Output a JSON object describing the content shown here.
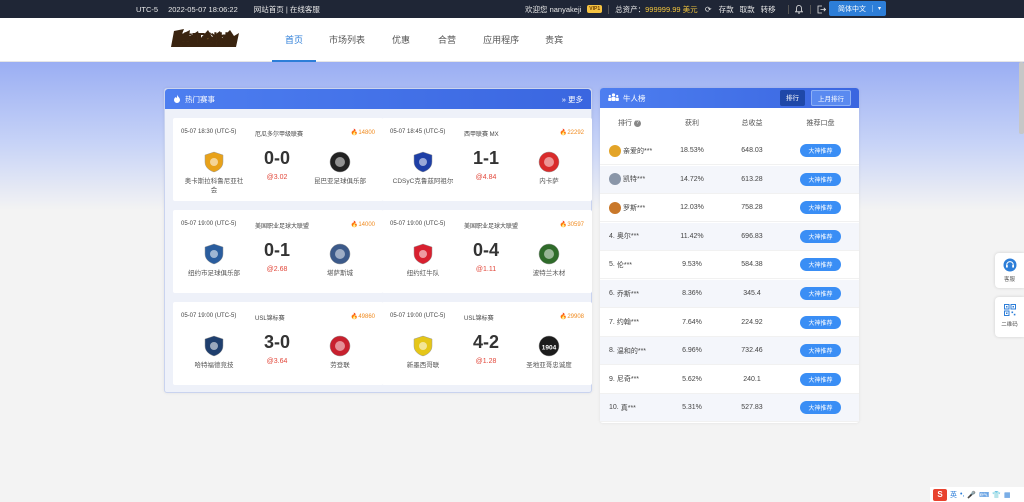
{
  "topbar": {
    "timezone": "UTC-5",
    "datetime": "2022-05-07 18:06:22",
    "links": "网站首页 | 在线客服",
    "welcome": "欢迎您 nanyakeji",
    "vip": "VIP1",
    "assets_label": "总资产：",
    "assets_value": "999999.99 美元",
    "deposit": "存款",
    "withdraw": "取款",
    "transfer": "转移",
    "language": "简体中文"
  },
  "nav": {
    "logo_text": "南亚科技",
    "items": [
      "首页",
      "市场列表",
      "优惠",
      "合营",
      "应用程序",
      "贵宾"
    ]
  },
  "hot": {
    "title": "热门赛事",
    "more": "更多",
    "matches": [
      {
        "time": "05-07 18:30 (UTC-5)",
        "league": "厄瓜多尔甲级联赛",
        "count": "14800",
        "home": "奥卡斯拉科鲁尼亚社会",
        "away": "昆巴亚足球俱乐部",
        "score": "0-0",
        "odds": "@3.02",
        "home_color": "#e8a21a",
        "away_color": "#222222"
      },
      {
        "time": "05-07 18:45 (UTC-5)",
        "league": "西甲联赛 MX",
        "count": "22292",
        "home": "CDSyC克鲁兹阿祖尔",
        "away": "内卡萨",
        "score": "1-1",
        "odds": "@4.84",
        "home_color": "#1e3fa6",
        "away_color": "#d92b2b"
      },
      {
        "time": "05-07 19:00 (UTC-5)",
        "league": "美国职业足球大联盟",
        "count": "14000",
        "home": "纽约市足球俱乐部",
        "away": "堪萨斯城",
        "score": "0-1",
        "odds": "@2.68",
        "home_color": "#2a5d9e",
        "away_color": "#3c5a8a"
      },
      {
        "time": "05-07 19:00 (UTC-5)",
        "league": "美国职业足球大联盟",
        "count": "30597",
        "home": "纽约红牛队",
        "away": "波特兰木材",
        "score": "0-4",
        "odds": "@1.11",
        "home_color": "#d8202f",
        "away_color": "#2f6b2a"
      },
      {
        "time": "05-07 19:00 (UTC-5)",
        "league": "USL锦标赛",
        "count": "49860",
        "home": "哈特福德竞技",
        "away": "劳登联",
        "score": "3-0",
        "odds": "@3.64",
        "home_color": "#1f3f6e",
        "away_color": "#c8202e"
      },
      {
        "time": "05-07 19:00 (UTC-5)",
        "league": "USL锦标赛",
        "count": "29908",
        "home": "新墨西哥联",
        "away": "圣地亚哥忠诚度",
        "score": "4-2",
        "odds": "@1.28",
        "home_color": "#e5c618",
        "away_color": "#1c1c1c",
        "away_text": "1904"
      }
    ]
  },
  "rank": {
    "title": "牛人榜",
    "tab_rank": "排行",
    "tab_last_month": "上月排行",
    "headers": [
      "排行",
      "获利",
      "总收益",
      "推荐口盘"
    ],
    "button_label": "大神推荐",
    "rows": [
      {
        "pos": "",
        "medal": "gold",
        "name": "亲爱的***",
        "profit": "18.53%",
        "total": "648.03"
      },
      {
        "pos": "",
        "medal": "silver",
        "name": "凯特***",
        "profit": "14.72%",
        "total": "613.28"
      },
      {
        "pos": "",
        "medal": "bronze",
        "name": "罗斯***",
        "profit": "12.03%",
        "total": "758.28"
      },
      {
        "pos": "4.",
        "medal": "",
        "name": "奥尔***",
        "profit": "11.42%",
        "total": "696.83"
      },
      {
        "pos": "5.",
        "medal": "",
        "name": "伦***",
        "profit": "9.53%",
        "total": "584.38"
      },
      {
        "pos": "6.",
        "medal": "",
        "name": "乔斯***",
        "profit": "8.36%",
        "total": "345.4"
      },
      {
        "pos": "7.",
        "medal": "",
        "name": "约翰***",
        "profit": "7.64%",
        "total": "224.92"
      },
      {
        "pos": "8.",
        "medal": "",
        "name": "温和的***",
        "profit": "6.96%",
        "total": "732.46"
      },
      {
        "pos": "9.",
        "medal": "",
        "name": "尼奇***",
        "profit": "5.62%",
        "total": "240.1"
      },
      {
        "pos": "10.",
        "medal": "",
        "name": "真***",
        "profit": "5.31%",
        "total": "527.83"
      }
    ]
  },
  "side": {
    "service": "客服",
    "qrcode": "二维码"
  },
  "tools": {
    "ime": "S",
    "en": "英"
  }
}
